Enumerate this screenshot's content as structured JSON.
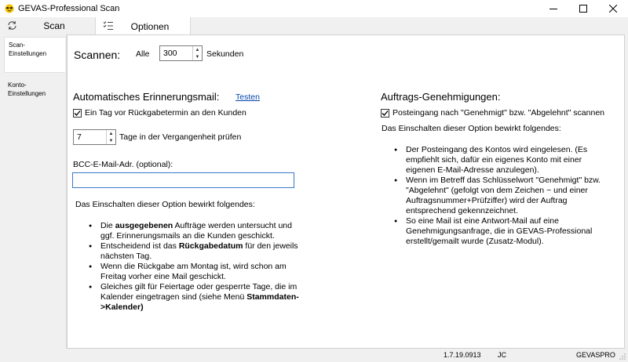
{
  "window": {
    "title": "GEVAS-Professional Scan",
    "icon": "sunglasses-app-icon",
    "controls": {
      "minimize": "minimize-icon",
      "maximize": "maximize-icon",
      "close": "close-icon"
    }
  },
  "tabs": [
    {
      "label": "Scan",
      "icon": "refresh-icon"
    },
    {
      "label": "Optionen",
      "icon": "checklist-icon"
    }
  ],
  "sidebar": {
    "items": [
      {
        "line1": "Scan-",
        "line2": "Einstellungen"
      },
      {
        "line1": "Konto-",
        "line2": "Einstellungen"
      }
    ]
  },
  "scan": {
    "heading": "Scannen:",
    "every_label": "Alle",
    "interval_value": "300",
    "seconds_label": "Sekunden"
  },
  "reminder": {
    "heading": "Automatisches Erinnerungsmail:",
    "test_link": "Testen",
    "checkbox_label": "Ein Tag vor Rückgabetermin an den Kunden",
    "checkbox_checked": true,
    "days_value": "7",
    "days_label": "Tage in der Vergangenheit prüfen",
    "bcc_label": "BCC-E-Mail-Adr. (optional):",
    "bcc_value": "",
    "info_intro": "Das Einschalten dieser Option bewirkt folgendes:",
    "bullets": [
      {
        "pre": "Die ",
        "bold": "ausgegebenen",
        "post": " Aufträge werden untersucht und ggf. Erinnerungsmails an die Kunden geschickt."
      },
      {
        "pre": "Entscheidend ist das ",
        "bold": "Rückgabedatum",
        "post": " für den jeweils nächsten Tag."
      },
      {
        "pre": "Wenn die Rückgabe am Montag ist, wird schon am Freitag vorher eine Mail geschickt.",
        "bold": "",
        "post": ""
      },
      {
        "pre": "Gleiches gilt für Feiertage oder gesperrte Tage, die im Kalender eingetragen sind (siehe Menü ",
        "bold": "Stammdaten->Kalender)",
        "post": ""
      }
    ]
  },
  "approvals": {
    "heading": "Auftrags-Genehmigungen:",
    "checkbox_label": "Posteingang nach \"Genehmigt\" bzw. \"Abgelehnt\" scannen",
    "checkbox_checked": true,
    "info_intro": "Das Einschalten dieser Option bewirkt folgendes:",
    "bullets": [
      "Der Posteingang des Kontos wird eingelesen. (Es empfiehlt sich, dafür ein eigenes Konto mit einer eigenen E-Mail-Adresse anzulegen).",
      "Wenn im Betreff das Schlüsselwort \"Genehmigt\" bzw. \"Abgelehnt\" (gefolgt von dem Zeichen ~ und einer Auftragsnummer+Prüfziffer) wird der Auftrag entsprechend gekennzeichnet.",
      "So eine Mail ist eine Antwort-Mail auf eine Genehmigungsanfrage, die in GEVAS-Professional erstellt/gemailt wurde (Zusatz-Modul)."
    ]
  },
  "statusbar": {
    "version": "1.7.19.0913",
    "user": "JC",
    "db": "GEVASPRO"
  }
}
